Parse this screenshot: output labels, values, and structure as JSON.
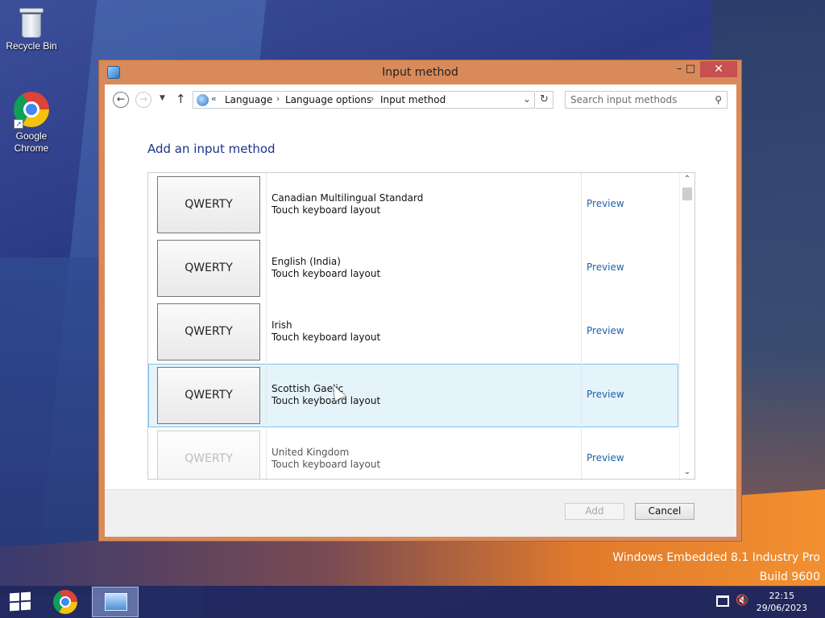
{
  "desktop": {
    "icons": [
      {
        "label": "Recycle Bin",
        "icon": "recycle-bin-icon"
      },
      {
        "label": "Google Chrome",
        "icon": "chrome-icon"
      }
    ],
    "watermark_line1": "Windows Embedded 8.1 Industry Pro",
    "watermark_line2": "Build 9600"
  },
  "window": {
    "title": "Input method",
    "controls": {
      "minimize": "–",
      "maximize": "□",
      "close": "✕"
    },
    "breadcrumb": {
      "overflow": "«",
      "items": [
        "Language",
        "Language options",
        "Input method"
      ],
      "separator": "›"
    },
    "search": {
      "placeholder": "Search input methods",
      "value": ""
    },
    "heading": "Add an input method",
    "list": [
      {
        "keyboard": "QWERTY",
        "name": "Canadian Multilingual Standard",
        "sub": "Touch keyboard layout",
        "action": "Preview",
        "selected": false
      },
      {
        "keyboard": "QWERTY",
        "name": "English (India)",
        "sub": "Touch keyboard layout",
        "action": "Preview",
        "selected": false
      },
      {
        "keyboard": "QWERTY",
        "name": "Irish",
        "sub": "Touch keyboard layout",
        "action": "Preview",
        "selected": false
      },
      {
        "keyboard": "QWERTY",
        "name": "Scottish Gaelic",
        "sub": "Touch keyboard layout",
        "action": "Preview",
        "selected": true
      },
      {
        "keyboard": "QWERTY",
        "name": "United Kingdom",
        "sub": "Touch keyboard layout",
        "action": "Preview",
        "selected": false
      }
    ],
    "buttons": {
      "add": "Add",
      "cancel": "Cancel"
    }
  },
  "taskbar": {
    "clock_time": "22:15",
    "clock_date": "29/06/2023"
  },
  "colors": {
    "titlebar": "#d98a5a",
    "close_button": "#c75050",
    "heading": "#1e3287",
    "link": "#1f62a8",
    "selection_bg": "#e5f3fb",
    "selection_border": "#7dc1e8"
  }
}
